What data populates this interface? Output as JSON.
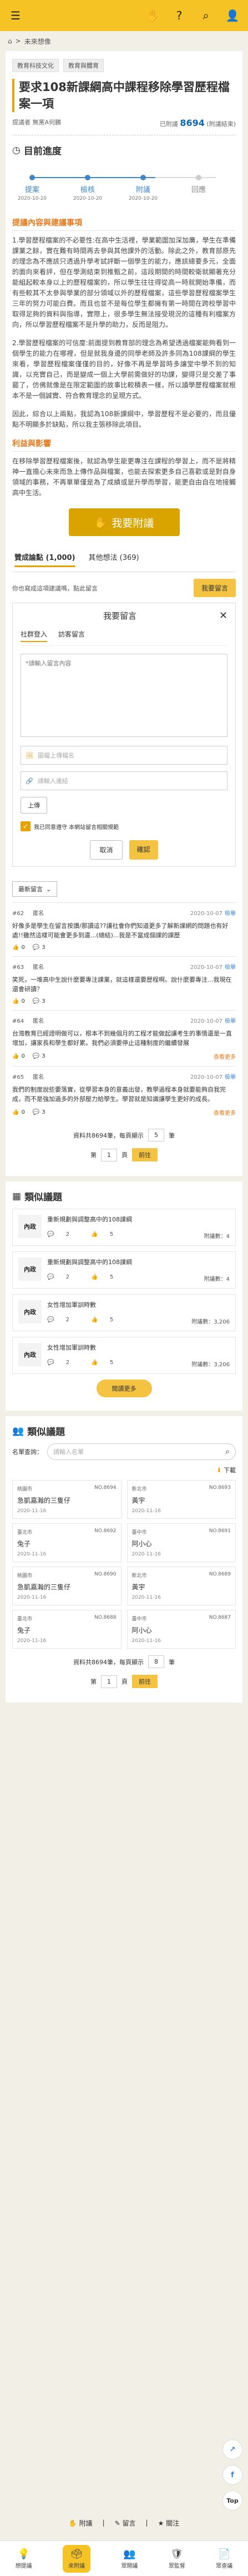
{
  "header": {
    "menu_icon": "hamburger-icon",
    "hand_icon": "wave-hand-icon",
    "help": "?",
    "search_icon": "search-icon",
    "user_icon": "user-icon"
  },
  "breadcrumb": {
    "home_icon": "home-icon",
    "separator": ">",
    "current": "未來想像"
  },
  "proposal": {
    "tags": [
      "教育科技文化",
      "教育與體育"
    ],
    "title": "要求108新課綱高中課程移除學習歷程檔案一項",
    "proposer_label": "提議者",
    "proposer": "無黨A何鵬",
    "signatures_prefix": "已附議",
    "signatures_count": "8694",
    "signatures_suffix": "(附議結束)"
  },
  "progress": {
    "title": "目前進度",
    "steps": [
      {
        "label": "提案",
        "date": "2020-10-20",
        "done": true
      },
      {
        "label": "檢核",
        "date": "2020-10-20",
        "done": true
      },
      {
        "label": "附議",
        "date": "2020-10-20",
        "done": true
      },
      {
        "label": "回應",
        "date": "",
        "done": false
      }
    ],
    "fill_fraction": 0.67
  },
  "content": {
    "sub_title_1": "提議內容與建議事項",
    "para_1": "1.學習歷程檔案的不必要性:在高中生活裡，學業範圍加深加廣，學生在準備課業之餘，實在難有時間再去參與其他課外的活動。除此之外，教育部原先的理念為不應該只透過升學考試評斷一個學生的能力，應該總要多元，全面的面向來看評，但在學測結束到推甄之前，這段期間的時間較衛就顯著充分能組起較本身以上的歷程檔案的，所以學生往往得從高一時就開始準備，而有些較其不太參與學業的部分領域以外的歷程檔案，這些學習歷程檔案學生三年的努力可能白費。而且也並不是每位學生都擁有第一時間在跨校學習中取得足夠的資料與指導，實際上，很多學生無法接受現況的這種有利檔案方向，所以學習歷程檔案不是升學的助力，反而是阻力。",
    "para_2": "2.學習歷程檔案的可信度:前面提到教育部的理念為希望透過檔案能夠看到一個學生的能力在哪裡，但是就我身邊的同學老師及許多同為108課綱的學生來看，學習歷程檔案僅僅的目的，好像不再是學習時多讓堂中學不到的知識，以充實自己，而是變成一個上大學前需做好的功課，變得只是交差了事罷了，仿佛就像是在限定範圍的故事比較積表一樣，所以讀學歷程檔案就根本不是一個誠實、符合教育理念的呈現方式。",
    "para_3": "因此，綜合以上兩點，我認為108新課綱中，學習歷程不是必要的，而且優點不明顯多於缺點，所以我主張移除此項目。",
    "sub_title_2": "利益與影響",
    "para_4": "在移除學習歷程檔案後，就認為學生能更專注在課程的學習上，而不是將精神一直擔心未來而急上傳作品與檔案，也能去探索更多自己喜歡或是對自身領域的事務，不再單單僅是為了成績或是升學而學習，能更自由自在地接觸高中生活。"
  },
  "support_button": {
    "icon": "hand-icon",
    "label": "我要附議"
  },
  "comment_tabs": [
    {
      "label": "贊成論點 (1,000)",
      "active": true
    },
    {
      "label": "其他想法 (369)",
      "active": false
    }
  ],
  "comment_prompt": "你也寫成這項建議嗎，點此留言",
  "leave_message_button": "我要留言",
  "modal": {
    "title": "我要留言",
    "close_icon": "close-icon",
    "login_tabs": [
      "社群登入",
      "訪客留言"
    ],
    "textarea_placeholder": "*請輸入留言內容",
    "image_placeholder": "圖檔上傳檔名",
    "link_placeholder": "請輸入連結",
    "upload_label": "上傳",
    "agree_text": "我已同意遵守 本網站留言相關規範",
    "cancel_label": "取消",
    "confirm_label": "確認"
  },
  "sort_dropdown": "最新留言",
  "comments": [
    {
      "no": "#62",
      "name": "匿名",
      "date": "2020-10-07",
      "report": "檢舉",
      "body": "好像多是學生在留言按讚/那讀這??讓社會你們知道更多了解新課網的問題也有好處!!雖然這樣可能會更多到遺...(總結)...我是不當成個課的課歷",
      "likes": "0",
      "replies": "3",
      "more": ""
    },
    {
      "no": "#63",
      "name": "匿名",
      "date": "2020-10-07",
      "report": "檢舉",
      "body": "笑死，一堆高中生說什麼要專注課業，就這樣還要歷程啊。說什麼要專注...我現在還會研讀？",
      "likes": "0",
      "replies": "3",
      "more": ""
    },
    {
      "no": "#64",
      "name": "匿名",
      "date": "2020-10-07",
      "report": "檢舉",
      "body": "台灣教育已經證明做可以，根本不到幾個月的工程才能做起讓考生的事情還是一直增加，讓家長和學生都好累。我們必須要停止這種制度的繼續發展",
      "likes": "0",
      "replies": "3",
      "more": "查看更多"
    },
    {
      "no": "#65",
      "name": "匿名",
      "date": "2020-10-07",
      "report": "檢舉",
      "body": "我們的制度說些要落實，從學習本身的意義出發，教學過程本身就要能夠自我完成，而不是強加過多的外部壓力給學生。學習就是知識讓學生更好的成長。",
      "likes": "0",
      "replies": "3",
      "more": "查看更多"
    }
  ],
  "pager": {
    "info": "資料共8694筆，每頁顯示",
    "per_page": "5",
    "unit": "筆",
    "page_prefix": "第",
    "page": "1",
    "page_suffix": "頁",
    "go": "前往"
  },
  "related": {
    "title": "類似議題",
    "items": [
      {
        "badge": "內政",
        "title": "重新規劃與調整高中的108課綱",
        "comments": "2",
        "likes": "5",
        "signs": "附議數：4"
      },
      {
        "badge": "內政",
        "title": "重新規劃與調整高中的108課綱",
        "comments": "2",
        "likes": "5",
        "signs": "附議數：4"
      },
      {
        "badge": "內政",
        "title": "女性增加軍訓時數",
        "comments": "2",
        "likes": "5",
        "signs": "附議數：3,206"
      },
      {
        "badge": "內政",
        "title": "女性增加軍訓時數",
        "comments": "2",
        "likes": "5",
        "signs": "附議數：3,206"
      }
    ],
    "more_label": "閱讀更多"
  },
  "similar": {
    "title": "類似議題",
    "search_label": "名單查詢：",
    "search_placeholder": "請輸入名單",
    "download": "下載",
    "entries": [
      {
        "city": "桃園市",
        "no": "NO.8694",
        "name": "急凱嘉瀚的三隻仔",
        "date": "2020-11-16"
      },
      {
        "city": "新北市",
        "no": "NO.8693",
        "name": "黃宇",
        "date": "2020-11-16"
      },
      {
        "city": "臺北市",
        "no": "NO.8692",
        "name": "兔子",
        "date": "2020-11-16"
      },
      {
        "city": "臺中市",
        "no": "NO.8691",
        "name": "阿小心",
        "date": "2020-11-16"
      },
      {
        "city": "桃園市",
        "no": "NO.8690",
        "name": "急凱嘉瀚的三隻仔",
        "date": "2020-11-16"
      },
      {
        "city": "新北市",
        "no": "NO.8689",
        "name": "黃宇",
        "date": "2020-11-16"
      },
      {
        "city": "臺北市",
        "no": "NO.8688",
        "name": "兔子",
        "date": "2020-11-16"
      },
      {
        "city": "臺中市",
        "no": "NO.8687",
        "name": "阿小心",
        "date": "2020-11-16"
      }
    ],
    "pager_info": "資料共8694筆，每頁顯示",
    "per_page": "8"
  },
  "floating": {
    "share": "↗",
    "facebook": "f",
    "top": "Top"
  },
  "action_bar": {
    "support": "附議",
    "comment": "留言",
    "follow": "關注"
  },
  "bottom_nav": [
    {
      "icon": "idea-icon",
      "label": "想提議",
      "active": false
    },
    {
      "icon": "vote-icon",
      "label": "來附議",
      "active": true
    },
    {
      "icon": "meeting-icon",
      "label": "眾開議",
      "active": false
    },
    {
      "icon": "policy-icon",
      "label": "眾監督",
      "active": false
    },
    {
      "icon": "doc-icon",
      "label": "眾查議",
      "active": false
    }
  ],
  "colors": {
    "brand": "#f6c324",
    "accent": "#3f86c6",
    "highlight": "#e47a1d"
  }
}
